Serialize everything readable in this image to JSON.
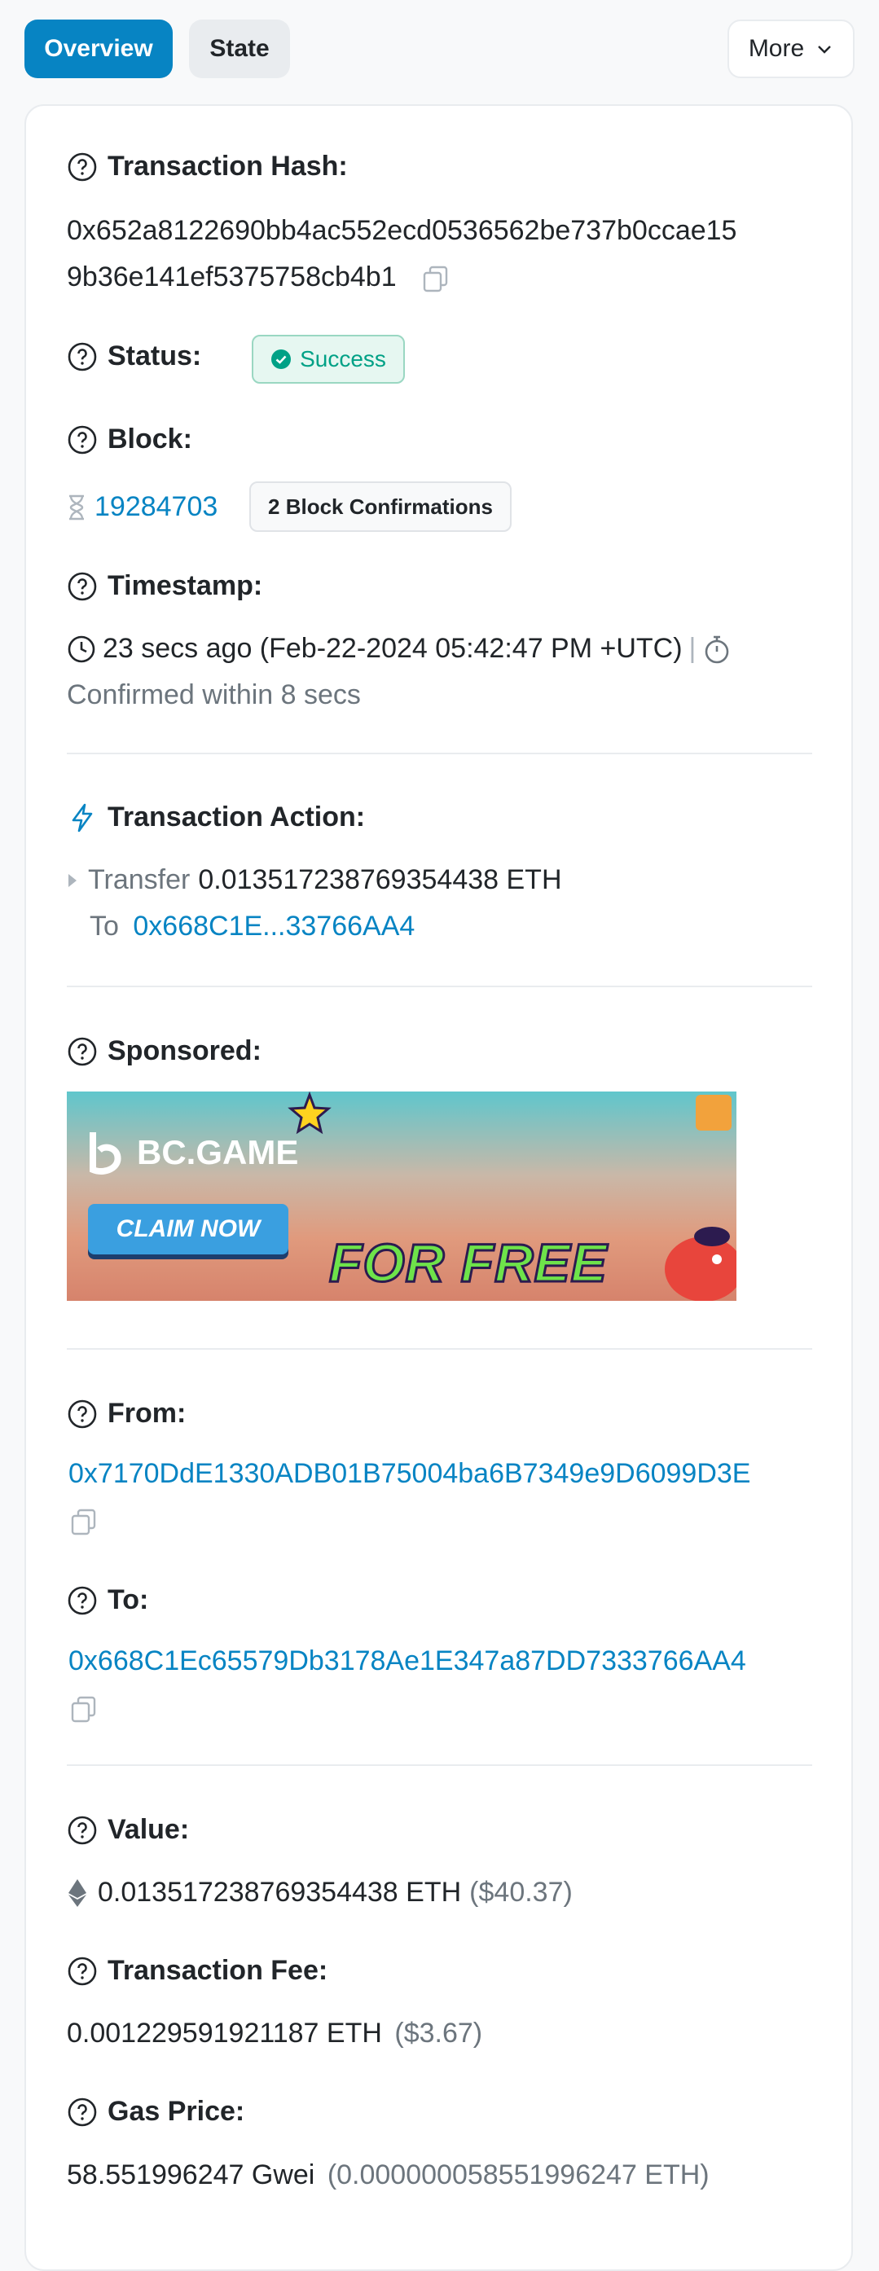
{
  "tabs": {
    "overview": "Overview",
    "state": "State",
    "more": "More"
  },
  "tx": {
    "hash_label": "Transaction Hash:",
    "hash_line1": "0x652a8122690bb4ac552ecd0536562be737b0ccae15",
    "hash_line2": "9b36e141ef5375758cb4b1",
    "status_label": "Status:",
    "status_value": "Success",
    "block_label": "Block:",
    "block_number": "19284703",
    "block_confirmations": "2 Block Confirmations",
    "timestamp_label": "Timestamp:",
    "timestamp_value": "23 secs ago (Feb-22-2024 05:42:47 PM +UTC)",
    "timestamp_sep": "|",
    "confirmed_within": "Confirmed within 8 secs",
    "action_label": "Transaction Action:",
    "action_verb": "Transfer",
    "action_amount": "0.013517238769354438 ETH",
    "action_to_word": "To",
    "action_to_addr": "0x668C1E...33766AA4",
    "sponsored_label": "Sponsored:",
    "ad": {
      "logo": "BC.GAME",
      "claim": "CLAIM NOW",
      "free": "FOR FREE"
    },
    "from_label": "From:",
    "from_addr": "0x7170DdE1330ADB01B75004ba6B7349e9D6099D3E",
    "to_label": "To:",
    "to_addr": "0x668C1Ec65579Db3178Ae1E347a87DD7333766AA4",
    "value_label": "Value:",
    "value_eth": "0.013517238769354438 ETH",
    "value_usd": "($40.37)",
    "fee_label": "Transaction Fee:",
    "fee_eth": "0.001229591921187 ETH",
    "fee_usd": "($3.67)",
    "gas_label": "Gas Price:",
    "gas_gwei": "58.551996247 Gwei",
    "gas_eth": "(0.000000058551996247 ETH)"
  },
  "colors": {
    "accent": "#0784c3",
    "success": "#00a186",
    "muted": "#6c757d"
  }
}
